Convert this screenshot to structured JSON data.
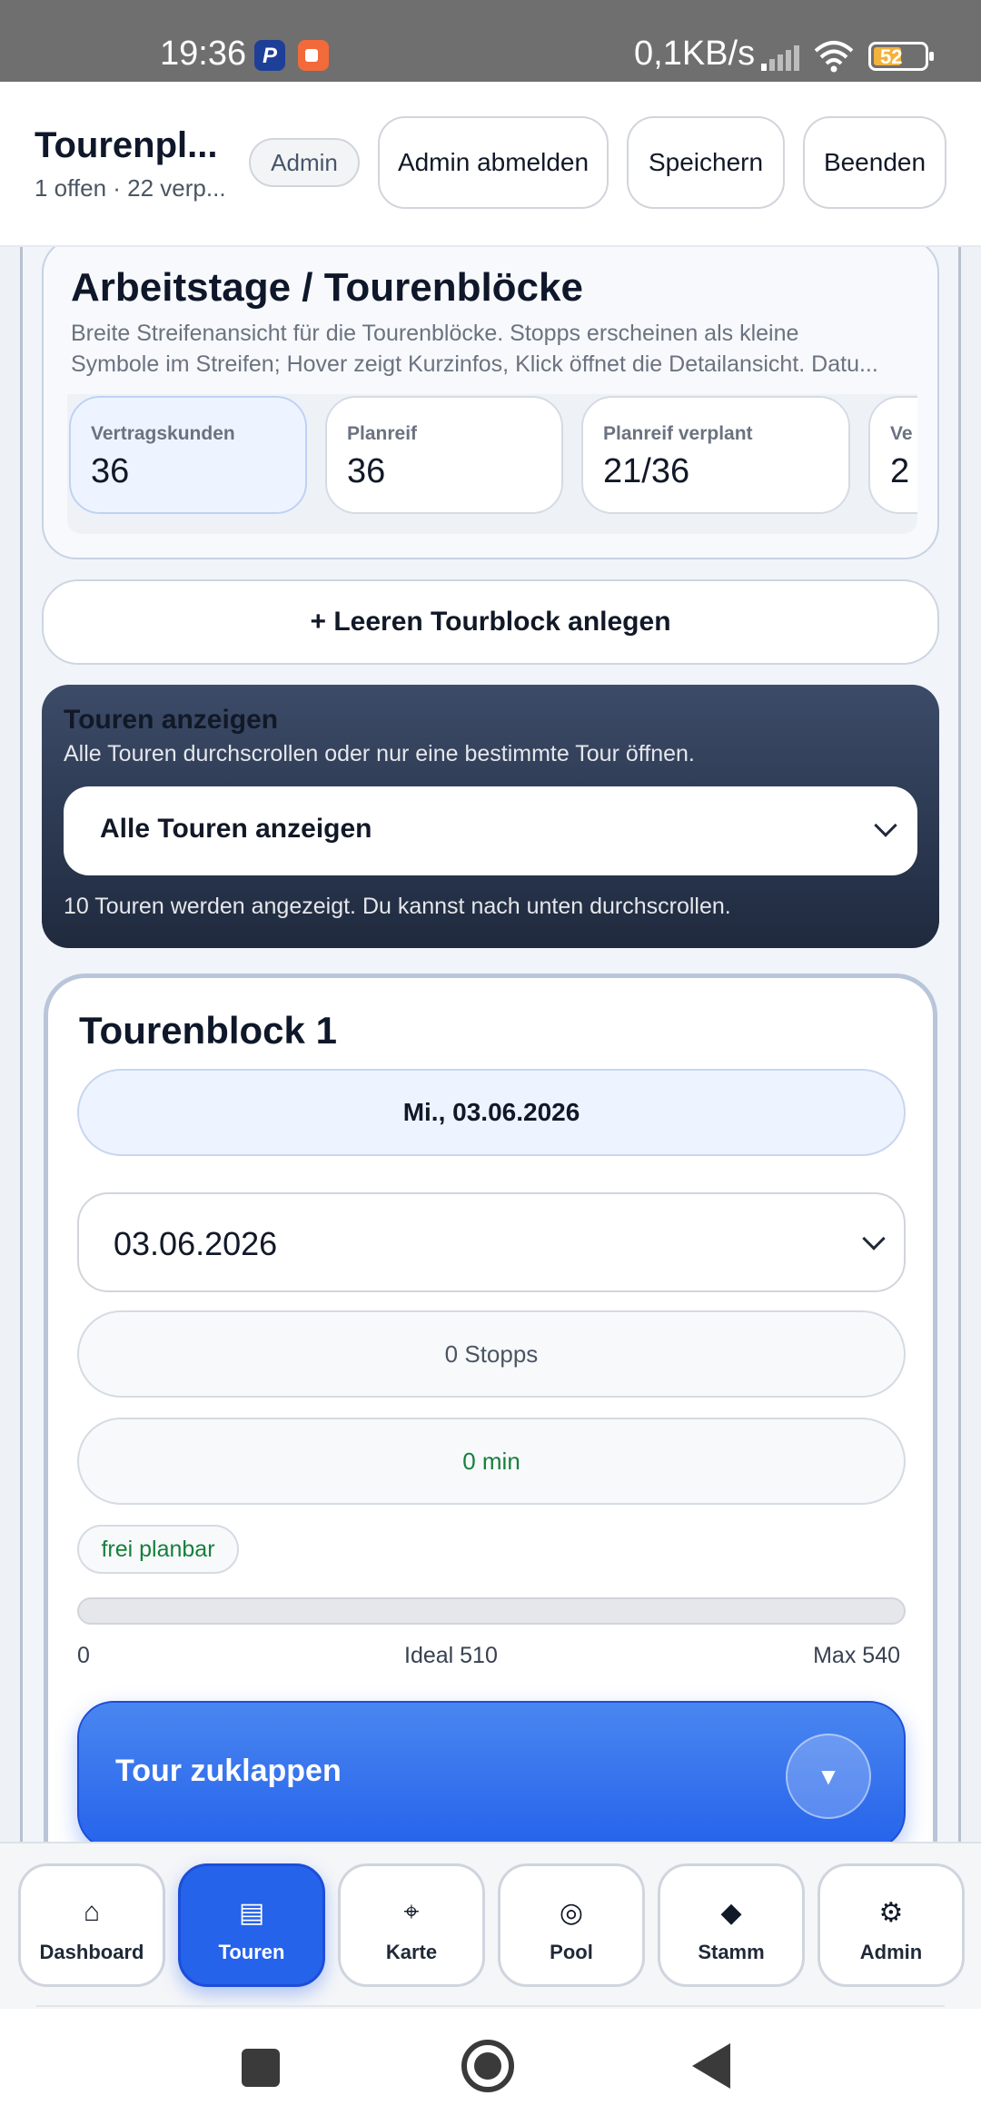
{
  "status_bar": {
    "time": "19:36",
    "network_speed": "0,1KB/s",
    "battery": "52",
    "icons": [
      "paypal-icon",
      "recorder-icon",
      "signal-icon",
      "wifi-icon",
      "battery-icon"
    ]
  },
  "header": {
    "title": "Tourenpl...",
    "subtitle": "1 offen · 22 verp...",
    "role_badge": "Admin",
    "buttons": {
      "logout_admin": "Admin abmelden",
      "save": "Speichern",
      "exit": "Beenden"
    }
  },
  "arbeitstage": {
    "title": "Arbeitstage / Tourenblöcke",
    "description_line1": "Breite Streifenansicht für die Tourenblöcke. Stopps erscheinen als kleine",
    "description_line2": "Symbole im Streifen; Hover zeigt Kurzinfos, Klick öffnet die Detailansicht. Datu...",
    "stats": [
      {
        "label": "Vertragskunden",
        "value": "36"
      },
      {
        "label": "Planreif",
        "value": "36"
      },
      {
        "label": "Planreif verplant",
        "value": "21/36"
      },
      {
        "label": "Ve",
        "value": "2"
      }
    ]
  },
  "add_block_label": "+ Leeren Tourblock anlegen",
  "tour_filter": {
    "title": "Touren anzeigen",
    "subtitle": "Alle Touren durchscrollen oder nur eine bestimmte Tour öffnen.",
    "selected": "Alle Touren anzeigen",
    "footer": "10 Touren werden angezeigt. Du kannst nach unten durchscrollen."
  },
  "tour_block": {
    "title": "Tourenblock 1",
    "date_chip": "Mi., 03.06.2026",
    "date_select": "03.06.2026",
    "stops": "0 Stopps",
    "minutes": "0 min",
    "status_badge": "frei planbar",
    "progress": {
      "value": 0,
      "ideal": 510,
      "max": 540,
      "fill_fraction": 0
    },
    "scale": {
      "min_label": "0",
      "ideal_label": "Ideal 510",
      "max_label": "Max 540"
    },
    "collapse_label": "Tour zuklappen",
    "collapse_icon": "▼"
  },
  "bottom_nav": [
    {
      "label": "Dashboard",
      "icon": "⌂",
      "icon_name": "home-icon",
      "active": false
    },
    {
      "label": "Touren",
      "icon": "▤",
      "icon_name": "list-icon",
      "active": true
    },
    {
      "label": "Karte",
      "icon": "⌖",
      "icon_name": "crosshair-icon",
      "active": false
    },
    {
      "label": "Pool",
      "icon": "◎",
      "icon_name": "target-icon",
      "active": false
    },
    {
      "label": "Stamm",
      "icon": "◆",
      "icon_name": "diamond-icon",
      "active": false
    },
    {
      "label": "Admin",
      "icon": "⚙",
      "icon_name": "gear-icon",
      "active": false
    }
  ],
  "colors": {
    "accent": "#2563eb",
    "success": "#15803d",
    "dark_card": "#1f2a3e"
  }
}
